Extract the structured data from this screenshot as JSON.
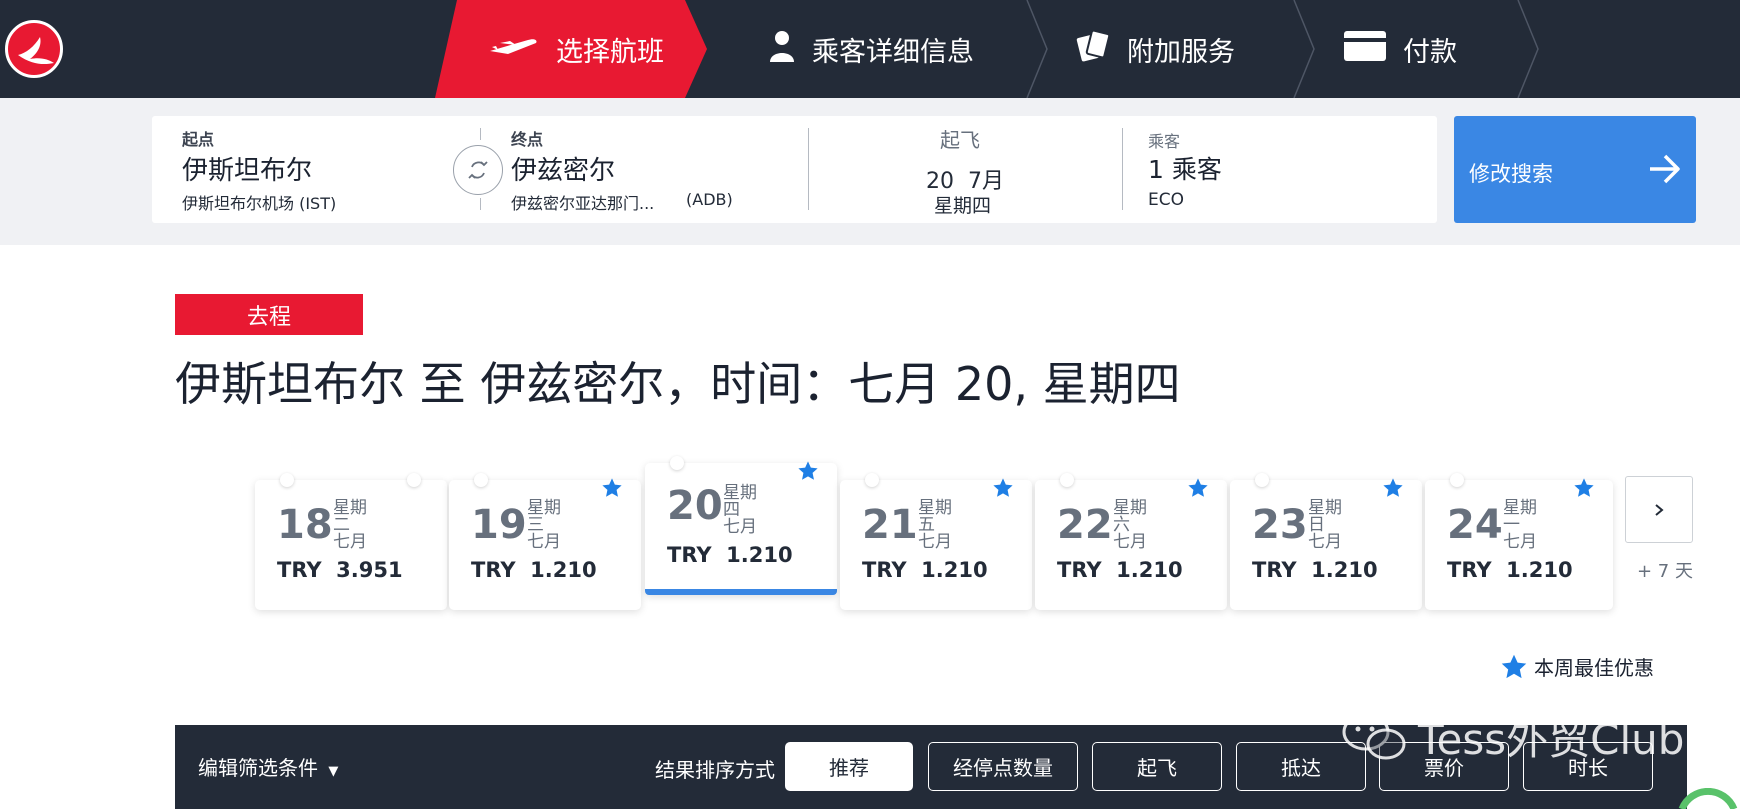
{
  "nav": {
    "steps": [
      {
        "label": "选择航班",
        "icon": "plane-icon",
        "active": true
      },
      {
        "label": "乘客详细信息",
        "icon": "person-icon",
        "active": false
      },
      {
        "label": "附加服务",
        "icon": "ticket-icon",
        "active": false
      },
      {
        "label": "付款",
        "icon": "card-icon",
        "active": false
      }
    ],
    "active_color": "#e81932",
    "bg_color": "#232b38"
  },
  "search": {
    "origin_label": "起点",
    "origin_city": "伊斯坦布尔",
    "origin_airport": "伊斯坦布尔机场 (IST)",
    "dest_label": "终点",
    "dest_city": "伊兹密尔",
    "dest_airport": "伊兹密尔亚达那门...",
    "dest_code": "(ADB)",
    "depart_label": "起飞",
    "depart_date": "20  7月",
    "depart_weekday": "星期四",
    "pax_label": "乘客",
    "pax_count": "1 乘客",
    "cabin": "ECO",
    "modify_label": "修改搜索",
    "modify_color": "#3a87e4"
  },
  "direction": {
    "badge": "去程",
    "title": "伊斯坦布尔 至 伊兹密尔，时间：七月 20, 星期四"
  },
  "dates": [
    {
      "day": "18",
      "weekday": "星期二",
      "month": "七月",
      "price": "TRY  3.951",
      "best": false,
      "selected": false
    },
    {
      "day": "19",
      "weekday": "星期三",
      "month": "七月",
      "price": "TRY  1.210",
      "best": true,
      "selected": false
    },
    {
      "day": "20",
      "weekday": "星期四",
      "month": "七月",
      "price": "TRY  1.210",
      "best": true,
      "selected": true
    },
    {
      "day": "21",
      "weekday": "星期五",
      "month": "七月",
      "price": "TRY  1.210",
      "best": true,
      "selected": false
    },
    {
      "day": "22",
      "weekday": "星期六",
      "month": "七月",
      "price": "TRY  1.210",
      "best": true,
      "selected": false
    },
    {
      "day": "23",
      "weekday": "星期日",
      "month": "七月",
      "price": "TRY  1.210",
      "best": true,
      "selected": false
    },
    {
      "day": "24",
      "weekday": "星期一",
      "month": "七月",
      "price": "TRY  1.210",
      "best": true,
      "selected": false
    }
  ],
  "more_days": "+ 7 天",
  "legend": "本周最佳优惠",
  "filter": {
    "edit_label": "编辑筛选条件",
    "sort_label": "结果排序方式",
    "sort_options": [
      "推荐",
      "经停点数量",
      "起飞",
      "抵达",
      "票价",
      "时长"
    ],
    "active_sort": "推荐"
  },
  "watermark": "Tess外贸Club"
}
